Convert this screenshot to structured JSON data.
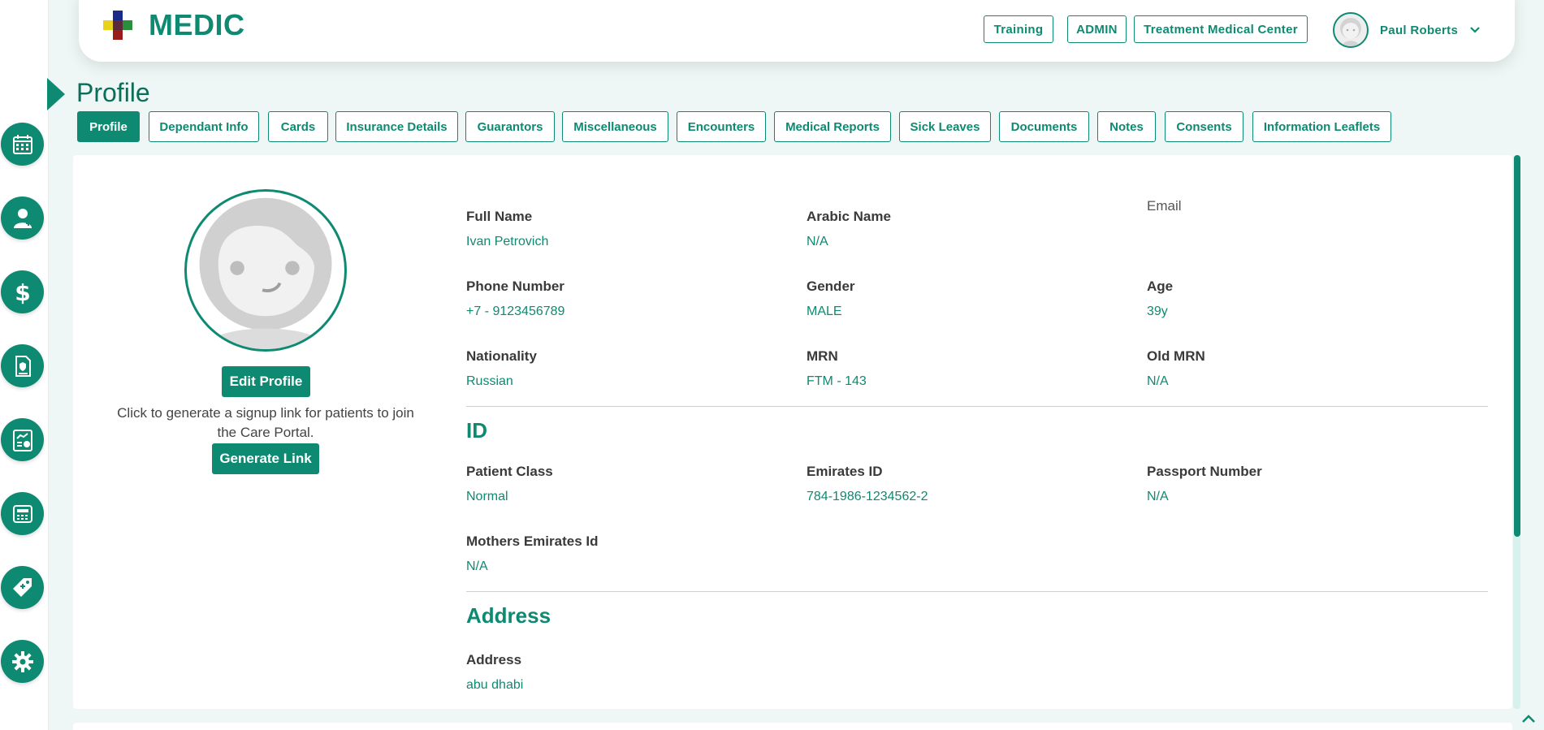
{
  "brand": {
    "name": "MEDIC",
    "accent": "#0e8a72"
  },
  "header": {
    "buttons": [
      "Training",
      "ADMIN",
      "Treatment Medical Center"
    ],
    "user_name": "Paul Roberts"
  },
  "sidebar": {
    "items": [
      "calendar-icon",
      "doctor-icon",
      "dollar-icon",
      "insurance-doc-icon",
      "report-chart-icon",
      "cash-register-icon",
      "medicine-tag-icon",
      "gear-icon"
    ]
  },
  "page": {
    "title": "Profile"
  },
  "tabs": [
    "Profile",
    "Dependant Info",
    "Cards",
    "Insurance Details",
    "Guarantors",
    "Miscellaneous",
    "Encounters",
    "Medical Reports",
    "Sick Leaves",
    "Documents",
    "Notes",
    "Consents",
    "Information Leaflets"
  ],
  "active_tab": "Profile",
  "profile": {
    "edit_label": "Edit Profile",
    "signup_text": "Click to generate a signup link for patients to join the Care Portal.",
    "generate_label": "Generate Link"
  },
  "personal": {
    "full_name": {
      "label": "Full Name",
      "value": "Ivan Petrovich"
    },
    "arabic_name": {
      "label": "Arabic Name",
      "value": "N/A"
    },
    "email": {
      "label": "Email",
      "value": ""
    },
    "phone": {
      "label": "Phone Number",
      "value": "+7 - 9123456789"
    },
    "gender": {
      "label": "Gender",
      "value": "MALE"
    },
    "age": {
      "label": "Age",
      "value": "39y"
    },
    "nationality": {
      "label": "Nationality",
      "value": "Russian"
    },
    "mrn": {
      "label": "MRN",
      "value": "FTM - 143"
    },
    "old_mrn": {
      "label": "Old MRN",
      "value": "N/A"
    }
  },
  "id_section": {
    "title": "ID",
    "patient_class": {
      "label": "Patient Class",
      "value": "Normal"
    },
    "emirates_id": {
      "label": "Emirates ID",
      "value": "784-1986-1234562-2"
    },
    "passport": {
      "label": "Passport Number",
      "value": "N/A"
    },
    "mothers_eid": {
      "label": "Mothers Emirates Id",
      "value": "N/A"
    }
  },
  "address_section": {
    "title": "Address",
    "address": {
      "label": "Address",
      "value": "abu dhabi"
    }
  }
}
